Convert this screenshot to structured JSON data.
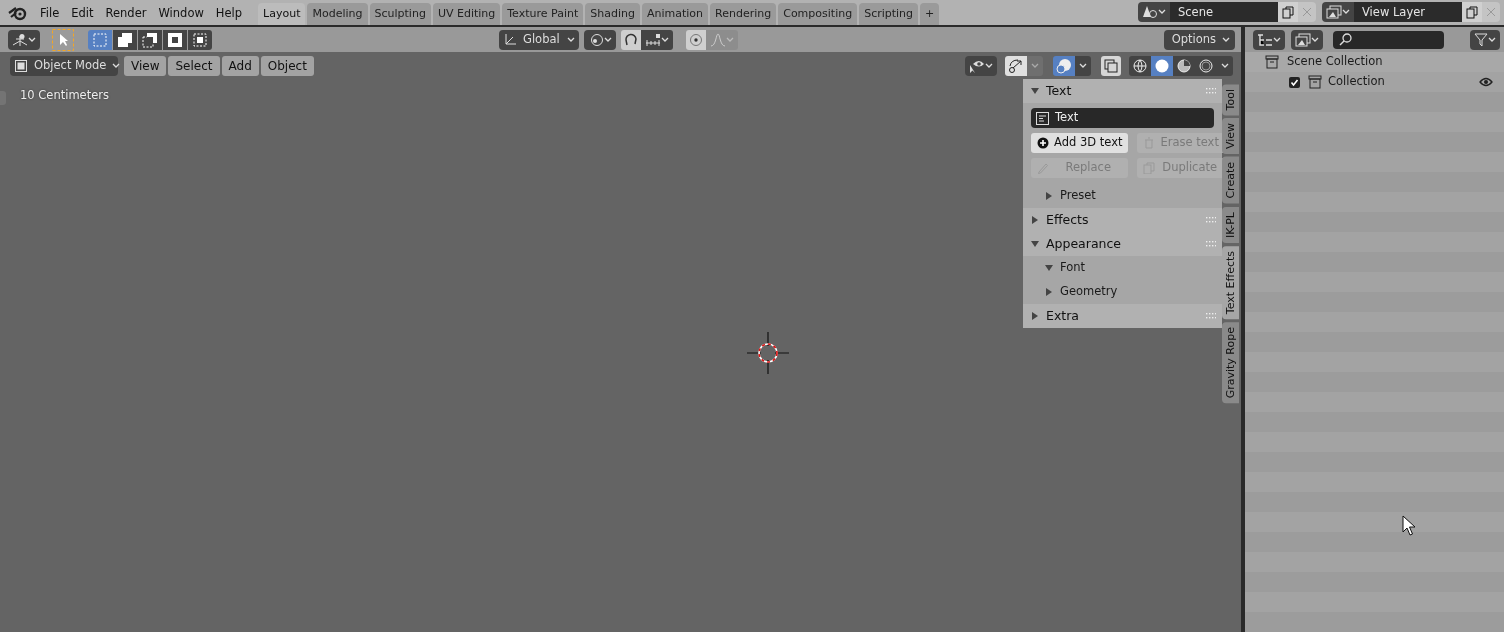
{
  "topbar": {
    "menus": [
      "File",
      "Edit",
      "Render",
      "Window",
      "Help"
    ],
    "workspaces": [
      {
        "label": "Layout",
        "selected": true
      },
      {
        "label": "Modeling",
        "selected": false
      },
      {
        "label": "Sculpting",
        "selected": false
      },
      {
        "label": "UV Editing",
        "selected": false
      },
      {
        "label": "Texture Paint",
        "selected": false
      },
      {
        "label": "Shading",
        "selected": false
      },
      {
        "label": "Animation",
        "selected": false
      },
      {
        "label": "Rendering",
        "selected": false
      },
      {
        "label": "Compositing",
        "selected": false
      },
      {
        "label": "Scripting",
        "selected": false
      }
    ],
    "add_workspace": "+",
    "scene": "Scene",
    "view_layer": "View Layer"
  },
  "tool_header": {
    "select_modes": [
      {
        "selected": true
      },
      {
        "selected": false
      },
      {
        "selected": false
      },
      {
        "selected": false
      },
      {
        "selected": false
      }
    ],
    "orientation": "Global",
    "options": "Options"
  },
  "viewport_header": {
    "mode": "Object Mode",
    "menus": [
      "View",
      "Select",
      "Add",
      "Object"
    ],
    "overlays_on": true,
    "shading_modes": [
      {
        "selected": false
      },
      {
        "selected": true
      },
      {
        "selected": false
      },
      {
        "selected": false
      }
    ]
  },
  "viewport": {
    "scale_text": "10 Centimeters"
  },
  "sidebar": {
    "panels": [
      {
        "title": "Text",
        "expanded": true,
        "field": "Text",
        "buttons": [
          {
            "label": "Add 3D text",
            "disabled": false
          },
          {
            "label": "Erase text",
            "disabled": true
          },
          {
            "label": "Replace",
            "disabled": true
          },
          {
            "label": "Duplicate",
            "disabled": true
          }
        ],
        "subpanels": [
          {
            "title": "Preset",
            "expanded": false
          }
        ]
      },
      {
        "title": "Effects",
        "expanded": false
      },
      {
        "title": "Appearance",
        "expanded": true,
        "subpanels": [
          {
            "title": "Font",
            "expanded": true
          },
          {
            "title": "Geometry",
            "expanded": false
          }
        ]
      },
      {
        "title": "Extra",
        "expanded": false
      }
    ],
    "tabs": [
      {
        "label": "Tool",
        "selected": false
      },
      {
        "label": "View",
        "selected": false
      },
      {
        "label": "Create",
        "selected": false
      },
      {
        "label": "IK-PL",
        "selected": false
      },
      {
        "label": "Text Effects",
        "selected": true
      },
      {
        "label": "Gravity Rope",
        "selected": false
      }
    ]
  },
  "outliner": {
    "rows": [
      {
        "label": "Scene Collection",
        "children": [
          {
            "label": "Collection",
            "checked": true,
            "visible": true
          }
        ]
      }
    ]
  }
}
